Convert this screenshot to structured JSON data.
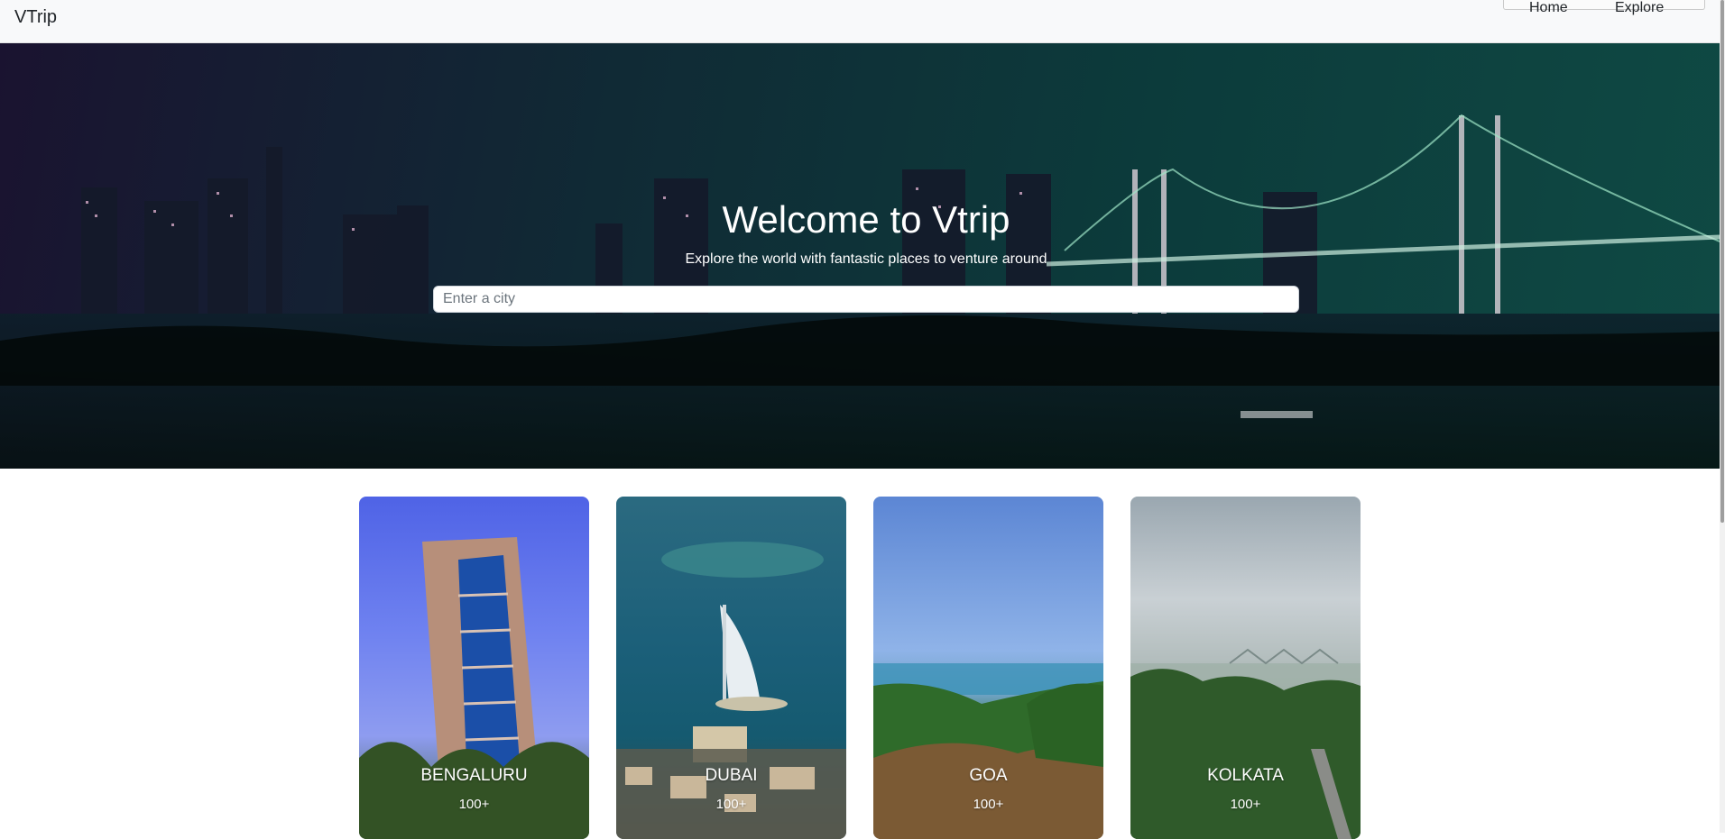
{
  "navbar": {
    "brand": "VTrip",
    "links": [
      {
        "label": "Home"
      },
      {
        "label": "Explore"
      }
    ]
  },
  "hero": {
    "title": "Welcome to Vtrip",
    "subtitle": "Explore the world with fantastic places to venture around",
    "search": {
      "placeholder": "Enter a city",
      "value": ""
    }
  },
  "cities": [
    {
      "name": "BENGALURU",
      "count": "100+"
    },
    {
      "name": "DUBAI",
      "count": "100+"
    },
    {
      "name": "GOA",
      "count": "100+"
    },
    {
      "name": "KOLKATA",
      "count": "100+"
    }
  ],
  "colors": {
    "navbar_bg": "#f8f9fa",
    "text": "#212529",
    "hero_text": "#ffffff"
  }
}
